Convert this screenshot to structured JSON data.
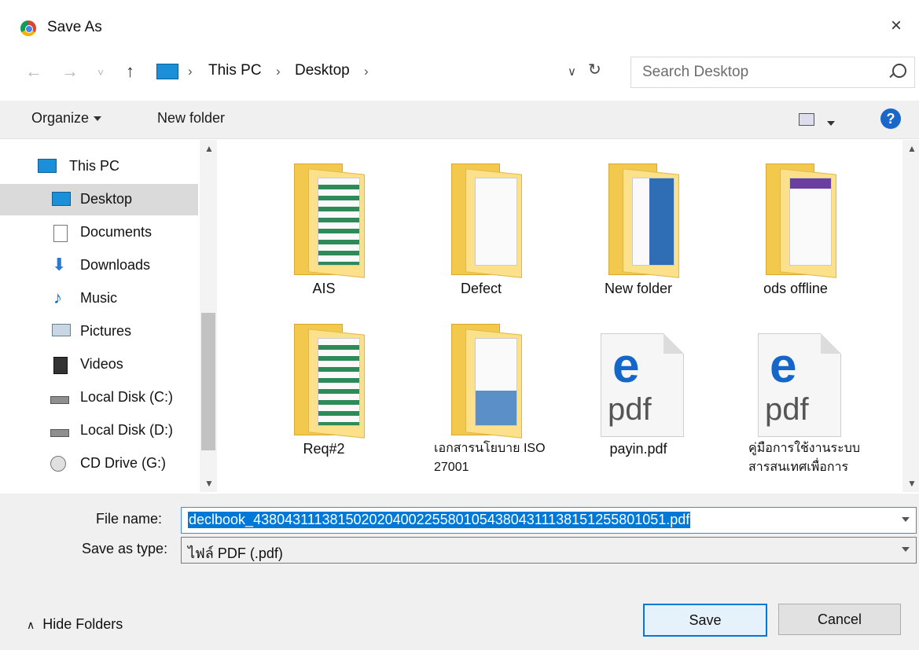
{
  "window": {
    "title": "Save As",
    "close_glyph": "×"
  },
  "navigation": {
    "back": "←",
    "forward": "→",
    "recent": "˅",
    "up": "↑"
  },
  "address": {
    "crumbs": [
      "This PC",
      "Desktop"
    ],
    "separator": "›"
  },
  "search": {
    "placeholder": "Search Desktop"
  },
  "toolbar": {
    "organize": "Organize",
    "new_folder": "New folder",
    "help": "?"
  },
  "sidebar": {
    "items": [
      {
        "label": "This PC",
        "icon": "computer-icon"
      },
      {
        "label": "Desktop",
        "icon": "desktop-icon",
        "selected": true
      },
      {
        "label": "Documents",
        "icon": "documents-icon"
      },
      {
        "label": "Downloads",
        "icon": "downloads-icon"
      },
      {
        "label": "Music",
        "icon": "music-icon"
      },
      {
        "label": "Pictures",
        "icon": "pictures-icon"
      },
      {
        "label": "Videos",
        "icon": "videos-icon"
      },
      {
        "label": "Local Disk (C:)",
        "icon": "drive-icon"
      },
      {
        "label": "Local Disk (D:)",
        "icon": "drive-icon"
      },
      {
        "label": "CD Drive (G:)",
        "icon": "cd-drive-icon"
      }
    ]
  },
  "files": [
    {
      "name": "AIS",
      "type": "folder"
    },
    {
      "name": "Defect",
      "type": "folder"
    },
    {
      "name": "New folder",
      "type": "folder"
    },
    {
      "name": "ods offline",
      "type": "folder"
    },
    {
      "name": "Req#2",
      "type": "folder"
    },
    {
      "name": "เอกสารนโยบาย ISO 27001",
      "type": "folder"
    },
    {
      "name": "payin.pdf",
      "type": "pdf"
    },
    {
      "name": "คู่มือการใช้งานระบบสารสนเทศเพื่อการ",
      "type": "pdf"
    }
  ],
  "pdf_icon": {
    "glyph": "e",
    "text": "pdf"
  },
  "form": {
    "file_name_label": "File name:",
    "file_name_value": "declbook_43804311138150202040022558010543804311138151255801051.pdf",
    "save_type_label": "Save as type:",
    "save_type_value": "ไฟล์ PDF (.pdf)"
  },
  "footer": {
    "hide_folders": "Hide Folders",
    "save": "Save",
    "cancel": "Cancel"
  },
  "colors": {
    "accent": "#0078d7",
    "selection": "#dadada",
    "folder": "#f2c94c"
  }
}
